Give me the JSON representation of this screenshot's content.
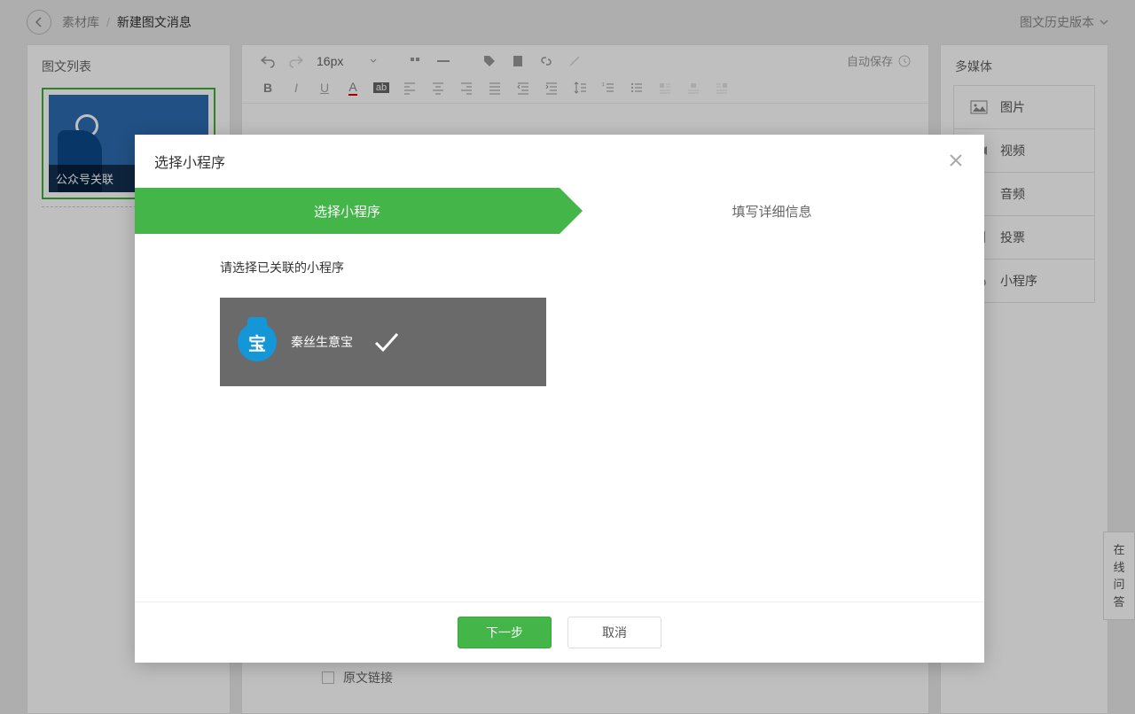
{
  "header": {
    "breadcrumb_root": "素材库",
    "breadcrumb_current": "新建图文消息",
    "history_label": "图文历史版本"
  },
  "left": {
    "title": "图文列表",
    "card_caption": "公众号关联"
  },
  "editor": {
    "font_size": "16px",
    "autosave": "自动保存",
    "original_link_label": "原文链接"
  },
  "media": {
    "title": "多媒体",
    "items": [
      "图片",
      "视频",
      "音频",
      "投票",
      "小程序"
    ]
  },
  "help": {
    "label": "在线问答"
  },
  "modal": {
    "title": "选择小程序",
    "step1": "选择小程序",
    "step2": "填写详细信息",
    "instruction": "请选择已关联的小程序",
    "mp_name": "秦丝生意宝",
    "mp_logo_char": "宝",
    "next": "下一步",
    "cancel": "取消"
  }
}
